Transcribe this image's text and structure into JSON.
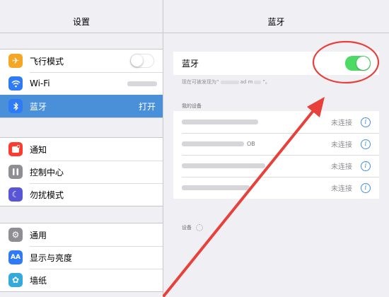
{
  "left": {
    "title": "设置",
    "groups": [
      [
        {
          "label": "飞行模式",
          "icon": "airplane-icon",
          "color": "#f5a623",
          "toggle": "off"
        },
        {
          "label": "Wi-Fi",
          "icon": "wifi-icon",
          "color": "#2f7bf5"
        },
        {
          "label": "蓝牙",
          "icon": "bluetooth-icon",
          "color": "#2f7bf5",
          "value": "打开",
          "selected": true
        }
      ],
      [
        {
          "label": "通知",
          "icon": "notifications-icon",
          "color": "#ff3b30"
        },
        {
          "label": "控制中心",
          "icon": "control-center-icon",
          "color": "#8e8e93"
        },
        {
          "label": "勿扰模式",
          "icon": "moon-icon",
          "color": "#5856d6"
        }
      ],
      [
        {
          "label": "通用",
          "icon": "gear-icon",
          "color": "#8e8e93"
        },
        {
          "label": "显示与亮度",
          "icon": "display-icon",
          "color": "#2f7bf5"
        },
        {
          "label": "墙纸",
          "icon": "wallpaper-icon",
          "color": "#34aadc"
        }
      ]
    ]
  },
  "right": {
    "title": "蓝牙",
    "bluetooth_label": "蓝牙",
    "bluetooth_on": true,
    "hint_prefix": "现在可被发现为“",
    "hint_mid": "ad m",
    "hint_suffix": "”。",
    "my_devices_title": "我的设备",
    "devices": [
      {
        "status": "未连接",
        "suffix": ""
      },
      {
        "status": "未连接",
        "suffix": "OB"
      },
      {
        "status": "未连接",
        "suffix": ""
      },
      {
        "status": "未连接",
        "suffix": ""
      }
    ],
    "other_devices_title": "设备"
  },
  "colors": {
    "selected": "#4a90d9",
    "toggle_on": "#4cd964",
    "annotation": "#e8413b"
  }
}
